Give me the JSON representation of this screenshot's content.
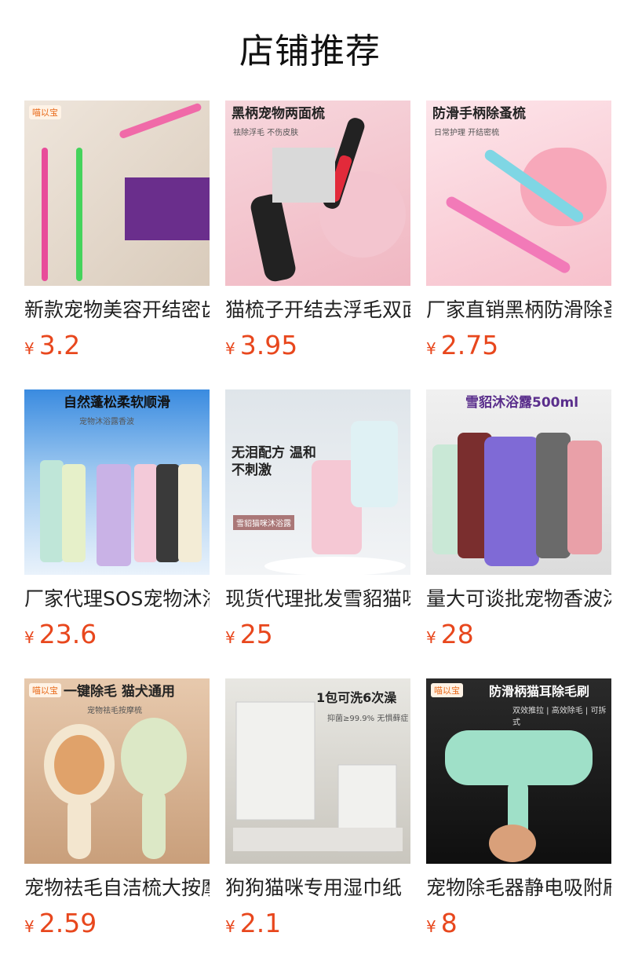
{
  "page_title": "店铺推荐",
  "currency_symbol": "¥",
  "products": [
    {
      "name": "新款宠物美容开结密齿梳",
      "price": "3.2",
      "img_caption": "",
      "img_sub": "",
      "badge": "喵以宝"
    },
    {
      "name": "猫梳子开结去浮毛双面梳",
      "price": "3.95",
      "img_caption": "黑柄宠物两面梳",
      "img_sub": "祛除浮毛 不伤皮肤",
      "badge": ""
    },
    {
      "name": "厂家直销黑柄防滑除蚤梳",
      "price": "2.75",
      "img_caption": "防滑手柄除蚤梳",
      "img_sub": "日常护理 开结密梳",
      "badge": ""
    },
    {
      "name": "厂家代理SOS宠物沐浴露",
      "price": "23.6",
      "img_caption": "自然蓬松柔软顺滑",
      "img_sub": "宠物沐浴露香波",
      "badge": ""
    },
    {
      "name": "现货代理批发雪貂猫咪沐浴露",
      "price": "25",
      "img_caption": "无泪配方 温和不刺激",
      "img_sub": "雪貂猫咪沐浴露",
      "badge": ""
    },
    {
      "name": "量大可谈批宠物香波沐浴露",
      "price": "28",
      "img_caption": "雪貂沐浴露500ml",
      "img_sub": "",
      "badge": ""
    },
    {
      "name": "宠物祛毛自洁梳大按摩梳",
      "price": "2.59",
      "img_caption": "一键除毛 猫犬通用",
      "img_sub": "宠物祛毛按摩梳",
      "badge": "喵以宝"
    },
    {
      "name": "狗狗猫咪专用湿巾纸",
      "price": "2.1",
      "img_caption": "1包可洗6次澡",
      "img_sub": "抑菌≥99.9% 无惧藓症",
      "badge": ""
    },
    {
      "name": "宠物除毛器静电吸附刷",
      "price": "8",
      "img_caption": "防滑柄猫耳除毛刷",
      "img_sub": "双效推拉 | 高效除毛 | 可拆式",
      "badge": "喵以宝"
    }
  ]
}
